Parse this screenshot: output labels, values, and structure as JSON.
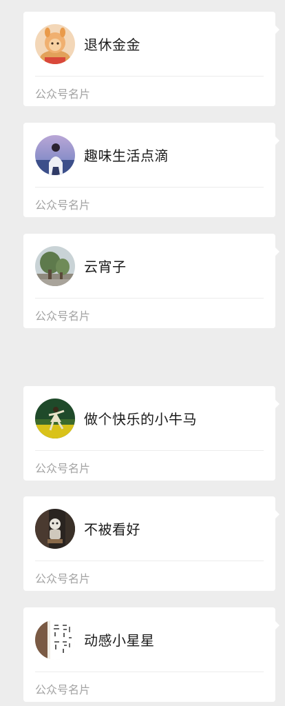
{
  "cards": [
    {
      "name": "退休金金",
      "footer": "公众号名片",
      "avatar_icon": "monkey-toy-avatar"
    },
    {
      "name": "趣味生活点滴",
      "footer": "公众号名片",
      "avatar_icon": "girl-by-lake-avatar"
    },
    {
      "name": "云宵子",
      "footer": "公众号名片",
      "avatar_icon": "tree-landscape-avatar"
    },
    {
      "name": "做个快乐的小牛马",
      "footer": "公众号名片",
      "avatar_icon": "dancer-in-field-avatar"
    },
    {
      "name": "不被看好",
      "footer": "公众号名片",
      "avatar_icon": "figurine-avatar"
    },
    {
      "name": "动感小星星",
      "footer": "公众号名片",
      "avatar_icon": "calligraphy-avatar"
    }
  ],
  "colors": {
    "background": "#ededed",
    "card": "#ffffff",
    "name_text": "#1a1a1a",
    "footer_text": "#a3a3a3"
  }
}
